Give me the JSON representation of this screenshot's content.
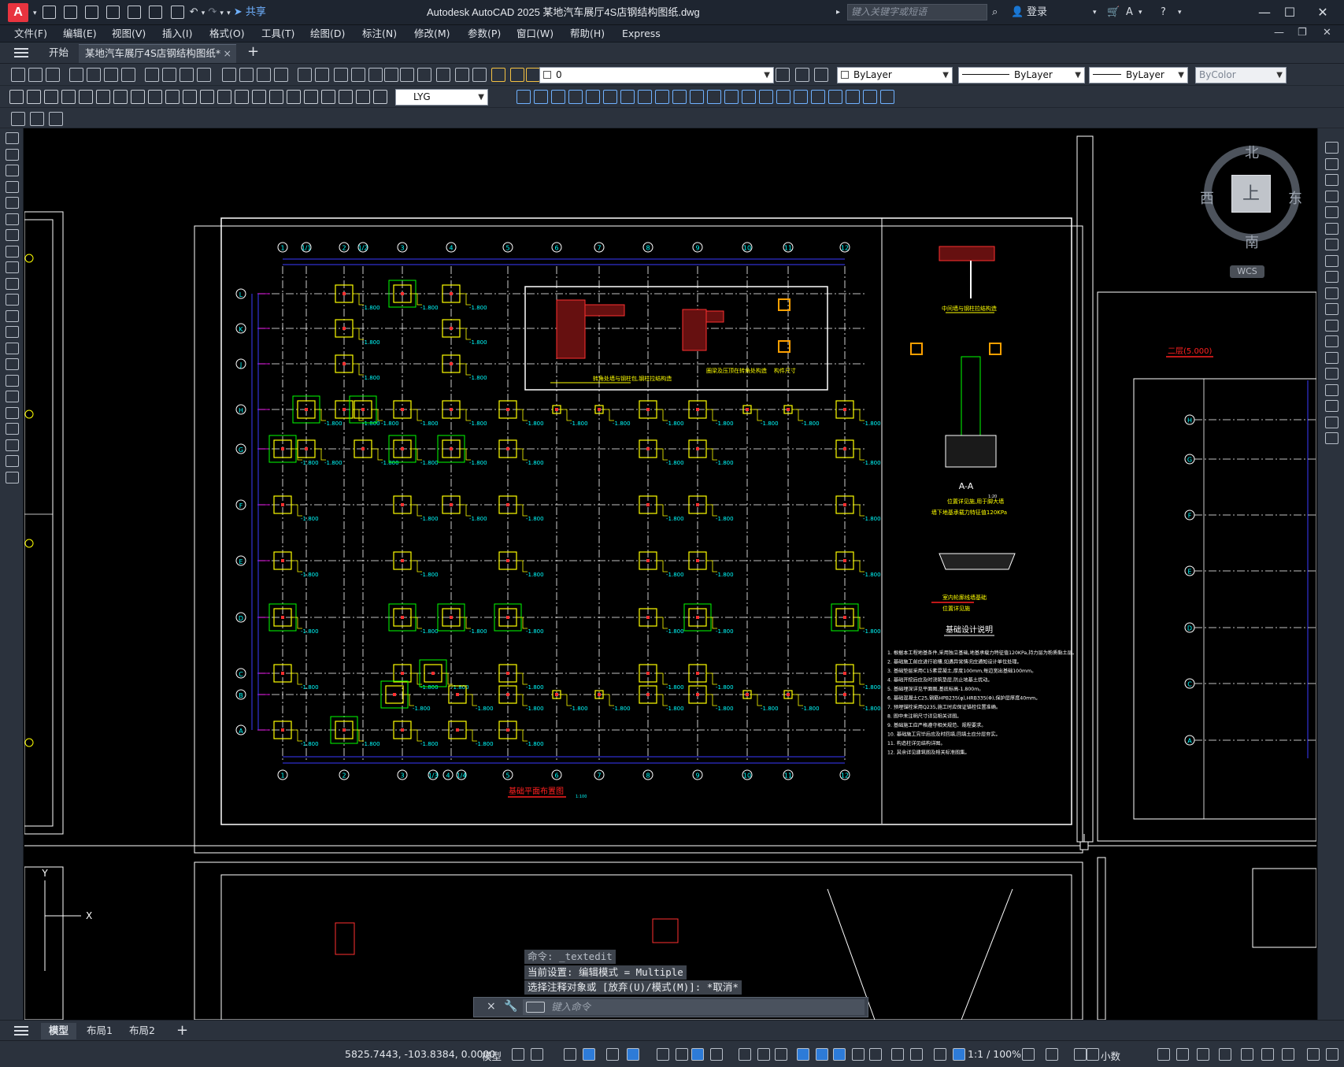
{
  "app": {
    "logo": "A",
    "title": "Autodesk AutoCAD 2025    某地汽车展厅4S店钢结构图纸.dwg",
    "share_label": "共享",
    "search_placeholder": "键入关键字或短语",
    "login_label": "登录"
  },
  "menu": {
    "items": [
      "文件(F)",
      "编辑(E)",
      "视图(V)",
      "插入(I)",
      "格式(O)",
      "工具(T)",
      "绘图(D)",
      "标注(N)",
      "修改(M)",
      "参数(P)",
      "窗口(W)",
      "帮助(H)",
      "Express"
    ]
  },
  "doc_tabs": {
    "start": "开始",
    "active": "某地汽车展厅4S店钢结构图纸*",
    "close": "×",
    "add": "+"
  },
  "toolbar": {
    "layer_value": "0",
    "color_value": "ByLayer",
    "linetype_value": "ByLayer",
    "lineweight_value": "ByLayer",
    "plotstyle_value": "ByColor",
    "textstyle_value": "LYG"
  },
  "viewcube": {
    "north": "北",
    "south": "南",
    "east": "东",
    "west": "西",
    "face": "上",
    "wcs": "WCS"
  },
  "drawing": {
    "plan_title": "基础平面布置图",
    "plan_scale": "1:100",
    "notes_title": "基础设计说明",
    "section_label": "A-A",
    "section_scale": "1:20",
    "detail1_title": "中间墙与钢柱拉结构造",
    "detail2_caption": "转角处墙与钢柱包,钢柱拉结构造",
    "detail3_caption": "圈梁及压顶在转角处构造",
    "detail4_caption": "构件尺寸",
    "found_note_1": "位置详见施,用于脚大墙",
    "found_note_2": "墙下地基承载力特征值120KPa",
    "indoor_title": "室内轮廓线墙基础",
    "indoor_sub": "位置详见施",
    "right_label": "二层(5.000)",
    "axis_top": [
      "1",
      "1/1",
      "2",
      "1/2",
      "3",
      "4",
      "5",
      "6",
      "7",
      "8",
      "9",
      "10",
      "11",
      "12"
    ],
    "axis_bottom": [
      "1",
      "2",
      "3",
      "1/3",
      "4",
      "1/4",
      "5",
      "6",
      "7",
      "8",
      "9",
      "10",
      "11",
      "12"
    ],
    "axis_left": [
      "L",
      "K",
      "J",
      "H",
      "G",
      "F",
      "E",
      "D",
      "C",
      "B",
      "A"
    ],
    "axis_right": [
      "H",
      "G",
      "F",
      "E",
      "D",
      "C",
      "A"
    ],
    "footing_elev": "-1.800",
    "notes_lines": [
      "1. 根据本工程地基条件,采用独立基础,地基承载力特征值120KPa,持力层为粉质黏土层。",
      "2. 基础施工前应进行验槽,如遇异常情况应通知设计单位处理。",
      "3. 基础垫层采用C15素混凝土,厚度100mm,每边宽出基础100mm。",
      "4. 基础开挖后应及时浇筑垫层,防止地基土扰动。",
      "5. 基础埋深详见平面图,基底标高-1.800m。",
      "6. 基础混凝土C25,钢筋HPB235(φ),HRB335(Φ),保护层厚度40mm。",
      "7. 预埋锚栓采用Q235,施工时应保证锚栓位置准确。",
      "8. 图中未注明尺寸详见相关详图。",
      "9. 基础施工应严格遵守相关规范、规程要求。",
      "10. 基础施工完毕后应及时回填,回填土应分层夯实。",
      "11. 构造柱详见结构详图。",
      "12. 其余详见建筑图及相关标准图集。"
    ]
  },
  "command": {
    "history": [
      "命令: _textedit",
      "当前设置: 编辑模式 = Multiple",
      "选择注释对象或 [放弃(U)/模式(M)]: *取消*"
    ],
    "placeholder": "键入命令",
    "close": "×"
  },
  "layout_tabs": {
    "items": [
      "模型",
      "布局1",
      "布局2"
    ],
    "add": "+"
  },
  "status": {
    "coords": "5825.7443, -103.8384, 0.0000",
    "model_label": "模型",
    "scale_label": "1:1 / 100%",
    "units_label": "小数"
  },
  "colors": {
    "accent": "#2d7bd8",
    "chrome": "#2b323d",
    "grid_cyan": "#00ffff",
    "dim_blue": "#3a3aff",
    "footing_yellow": "#ffff00",
    "title_red": "#ff2020",
    "green": "#00ff00"
  }
}
